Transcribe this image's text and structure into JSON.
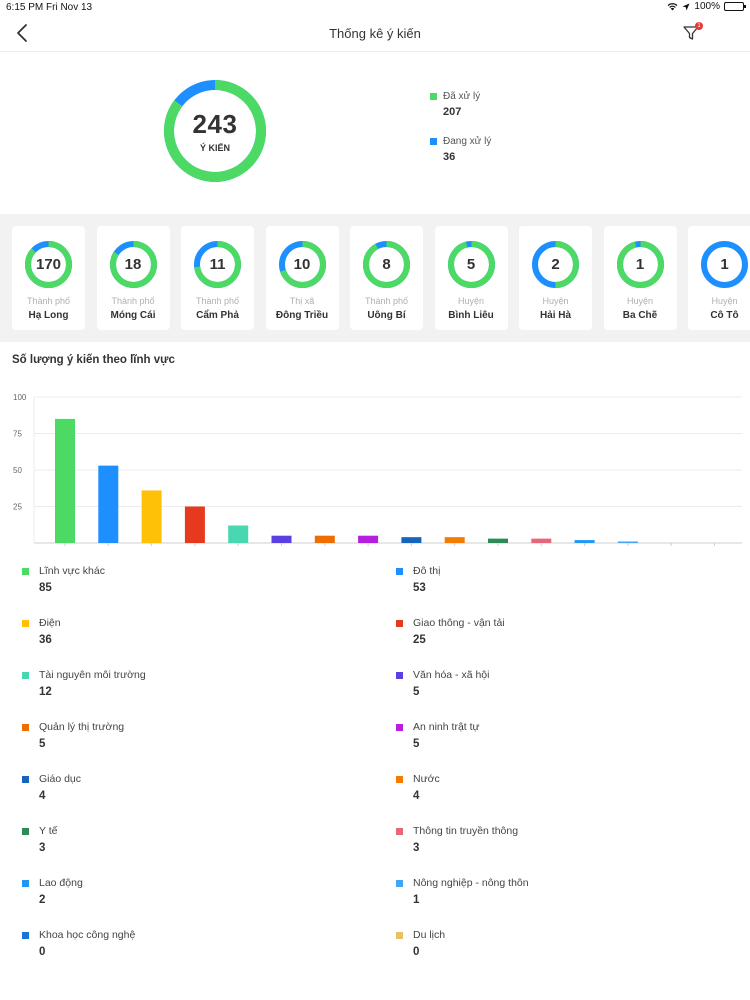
{
  "status_bar": {
    "time": "6:15 PM",
    "date": "Fri Nov 13",
    "battery": "100%"
  },
  "nav": {
    "title": "Thống kê ý kiến",
    "filter_badge": "1"
  },
  "summary": {
    "total": "243",
    "unit": "Ý KIẾN",
    "legend": [
      {
        "label": "Đã xử lý",
        "value": "207",
        "color": "#4cd964"
      },
      {
        "label": "Đang xử lý",
        "value": "36",
        "color": "#1e8fff"
      }
    ],
    "processed_fraction": 0.852
  },
  "districts": [
    {
      "count": "170",
      "type": "Thành phố",
      "name": "Hạ Long",
      "processed_fraction": 0.87
    },
    {
      "count": "18",
      "type": "Thành phố",
      "name": "Móng Cái",
      "processed_fraction": 0.84
    },
    {
      "count": "11",
      "type": "Thành phố",
      "name": "Cẩm Phả",
      "processed_fraction": 0.73
    },
    {
      "count": "10",
      "type": "Thị xã",
      "name": "Đông Triều",
      "processed_fraction": 0.7
    },
    {
      "count": "8",
      "type": "Thành phố",
      "name": "Uông Bí",
      "processed_fraction": 0.92
    },
    {
      "count": "5",
      "type": "Huyện",
      "name": "Bình Liêu",
      "processed_fraction": 0.96
    },
    {
      "count": "2",
      "type": "Huyện",
      "name": "Hải Hà",
      "processed_fraction": 0.5
    },
    {
      "count": "1",
      "type": "Huyện",
      "name": "Ba Chẽ",
      "processed_fraction": 0.96
    },
    {
      "count": "1",
      "type": "Huyện",
      "name": "Cô Tô",
      "processed_fraction": 0.0
    }
  ],
  "chart_section_title": "Số lượng ý kiến theo lĩnh vực",
  "chart_data": {
    "type": "bar",
    "categories": [
      "Lĩnh vực khác",
      "Đô thị",
      "Điện",
      "Giao thông - vận tải",
      "Tài nguyên môi trường",
      "Văn hóa - xã hội",
      "Quản lý thị trường",
      "An ninh trật tự",
      "Giáo dục",
      "Nước",
      "Y tế",
      "Thông tin truyền thông",
      "Lao động",
      "Nông nghiệp - nông thôn",
      "Khoa học công nghệ",
      "Du lịch"
    ],
    "values": [
      85,
      53,
      36,
      25,
      12,
      5,
      5,
      5,
      4,
      4,
      3,
      3,
      2,
      1,
      0,
      0
    ],
    "colors": [
      "#4cd964",
      "#1e8fff",
      "#ffc107",
      "#e53a1e",
      "#48d7b0",
      "#5b3fe0",
      "#ef6c00",
      "#b61ee0",
      "#1565c0",
      "#f57c00",
      "#2e8b57",
      "#e8667a",
      "#2196f3",
      "#42a5f5",
      "#1976d2",
      "#e8c06a"
    ],
    "yticks": [
      25,
      50,
      75,
      100
    ],
    "ylim": [
      0,
      100
    ],
    "grid": true
  }
}
